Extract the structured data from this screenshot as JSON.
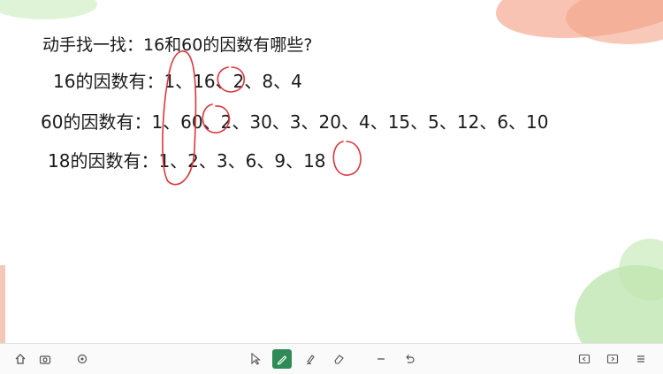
{
  "slide": {
    "title_line": "动手找一找：16和60的因数有哪些?",
    "line_16": "16的因数有：1、16、2、8、4",
    "line_60": "60的因数有：1、60、2、30、3、20、4、15、5、12、6、10",
    "line_18": "18的因数有：1、2、3、6、9、18"
  },
  "annotations": {
    "ink_color": "#d9363e"
  },
  "toolbar": {
    "left_tools": [
      "home-icon",
      "camera-icon",
      "settings-icon"
    ],
    "center_tools": [
      "cursor-icon",
      "pen-icon",
      "highlighter-icon",
      "eraser-icon",
      "minus-icon",
      "undo-icon"
    ],
    "right_tools": [
      "prev-icon",
      "next-icon",
      "menu-icon"
    ]
  }
}
